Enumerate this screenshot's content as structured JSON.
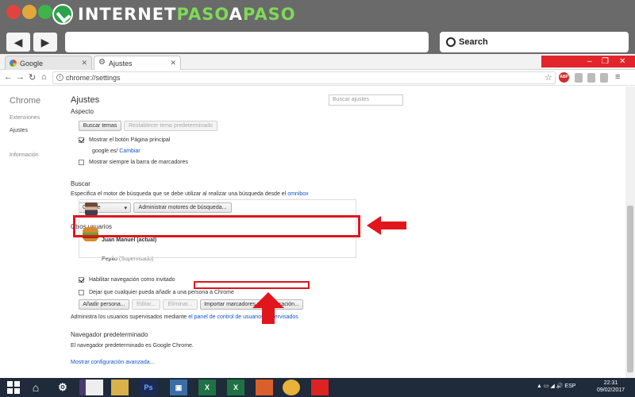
{
  "brand": {
    "part1": "INTERNET",
    "part2": "PASO",
    "part3": "A",
    "part4": "PASO"
  },
  "outer": {
    "search_label": "Search"
  },
  "tabs": [
    {
      "label": "Google"
    },
    {
      "label": "Ajustes"
    }
  ],
  "toolbar": {
    "url": "chrome://settings"
  },
  "sidebar": {
    "title": "Chrome",
    "items": [
      {
        "label": "Extensiones"
      },
      {
        "label": "Ajustes"
      },
      {
        "label": "Información"
      }
    ]
  },
  "settings": {
    "title": "Ajustes",
    "search_placeholder": "Buscar ajustes",
    "aspecto": {
      "heading": "Aspecto",
      "btn_themes": "Buscar temas",
      "btn_reset_theme": "Restablecer tema predeterminado",
      "show_home": "Mostrar el botón Página principal",
      "home_url": "google.es/",
      "home_change": "Cambiar",
      "show_bookmarks": "Mostrar siempre la barra de marcadores"
    },
    "buscar": {
      "heading": "Buscar",
      "desc": "Especifica el motor de búsqueda que se debe utilizar al realizar una búsqueda desde el",
      "desc_link": "omnibox",
      "engine": "Google",
      "btn_manage": "Administrar motores de búsqueda..."
    },
    "usuarios": {
      "heading": "Otros usuarios",
      "user1": "Juan Manuel (actual)",
      "user2": "Pepito",
      "user2_tag": "(Supervisado)",
      "guest": "Habilitar navegación como invitado",
      "anyone_add": "Dejar que cualquier pueda añadir a una persona a Chrome",
      "btn_add": "Añadir persona...",
      "btn_edit": "Editar...",
      "btn_remove": "Eliminar...",
      "btn_import": "Importar marcadores y configuración...",
      "supervised_text": "Administra los usuarios supervisados mediante",
      "supervised_link": "el panel de control de usuarios supervisados"
    },
    "navegador": {
      "heading": "Navegador predeterminado",
      "desc": "El navegador predeterminado es Google Chrome."
    },
    "advanced_link": "Mostrar configuración avanzada..."
  },
  "taskbar": {
    "lang": "ESP",
    "time": "22:31",
    "date": "09/02/2017"
  },
  "colors": {
    "highlight": "#e0161c",
    "link": "#1155cc"
  }
}
